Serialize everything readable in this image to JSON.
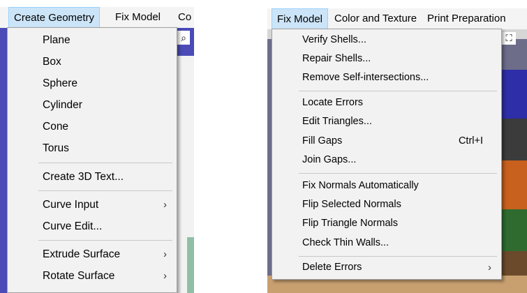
{
  "left": {
    "menubar": [
      "Create Geometry",
      "Fix Model",
      "Co"
    ],
    "menu": [
      {
        "label": "Plane"
      },
      {
        "label": "Box"
      },
      {
        "label": "Sphere"
      },
      {
        "label": "Cylinder"
      },
      {
        "label": "Cone"
      },
      {
        "label": "Torus"
      },
      {
        "label": "Create 3D Text..."
      },
      {
        "label": "Curve Input",
        "submenu": true
      },
      {
        "label": "Curve Edit..."
      },
      {
        "label": "Extrude Surface",
        "submenu": true
      },
      {
        "label": "Rotate Surface",
        "submenu": true
      }
    ]
  },
  "right": {
    "menubar": [
      "Fix Model",
      "Color and Texture",
      "Print Preparation"
    ],
    "menu": [
      {
        "label": "Verify Shells..."
      },
      {
        "label": "Repair Shells..."
      },
      {
        "label": "Remove Self-intersections..."
      },
      {
        "label": "Locate Errors"
      },
      {
        "label": "Edit Triangles..."
      },
      {
        "label": "Fill Gaps",
        "shortcut": "Ctrl+I"
      },
      {
        "label": "Join Gaps..."
      },
      {
        "label": "Fix Normals Automatically"
      },
      {
        "label": "Flip Selected Normals"
      },
      {
        "label": "Flip Triangle Normals"
      },
      {
        "label": "Check Thin Walls..."
      },
      {
        "label": "Delete Errors",
        "submenu": true
      }
    ]
  },
  "icons": {
    "submenu_arrow": "›"
  }
}
